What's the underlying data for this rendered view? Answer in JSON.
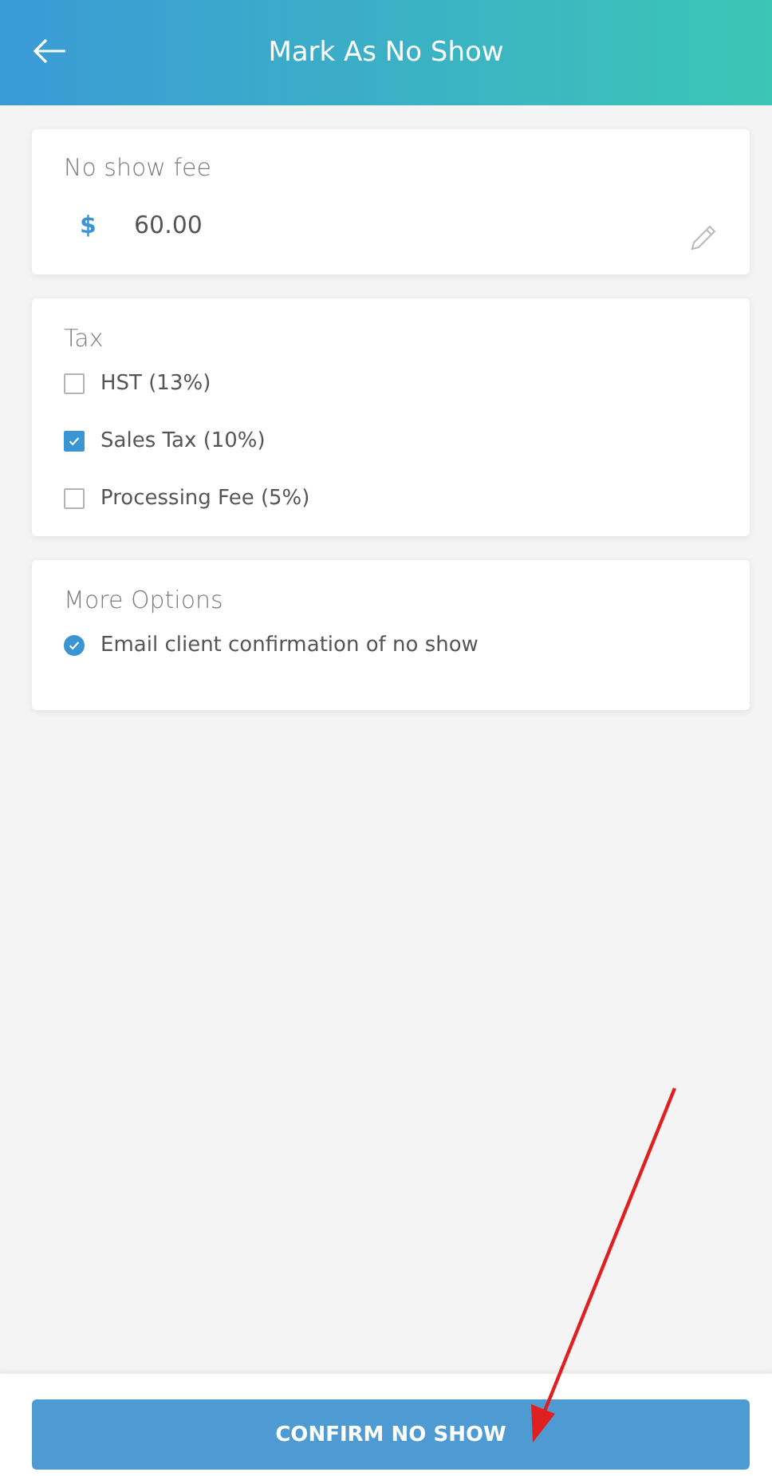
{
  "header": {
    "title": "Mark As No Show"
  },
  "fee": {
    "label": "No show fee",
    "currency": "$",
    "value": "60.00"
  },
  "tax": {
    "title": "Tax",
    "items": [
      {
        "label": "HST (13%)",
        "checked": false
      },
      {
        "label": "Sales Tax (10%)",
        "checked": true
      },
      {
        "label": "Processing Fee (5%)",
        "checked": false
      }
    ]
  },
  "more_options": {
    "title": "More Options",
    "items": [
      {
        "label": "Email client confirmation of no show",
        "checked": true
      }
    ]
  },
  "confirm_button": "CONFIRM NO SHOW"
}
